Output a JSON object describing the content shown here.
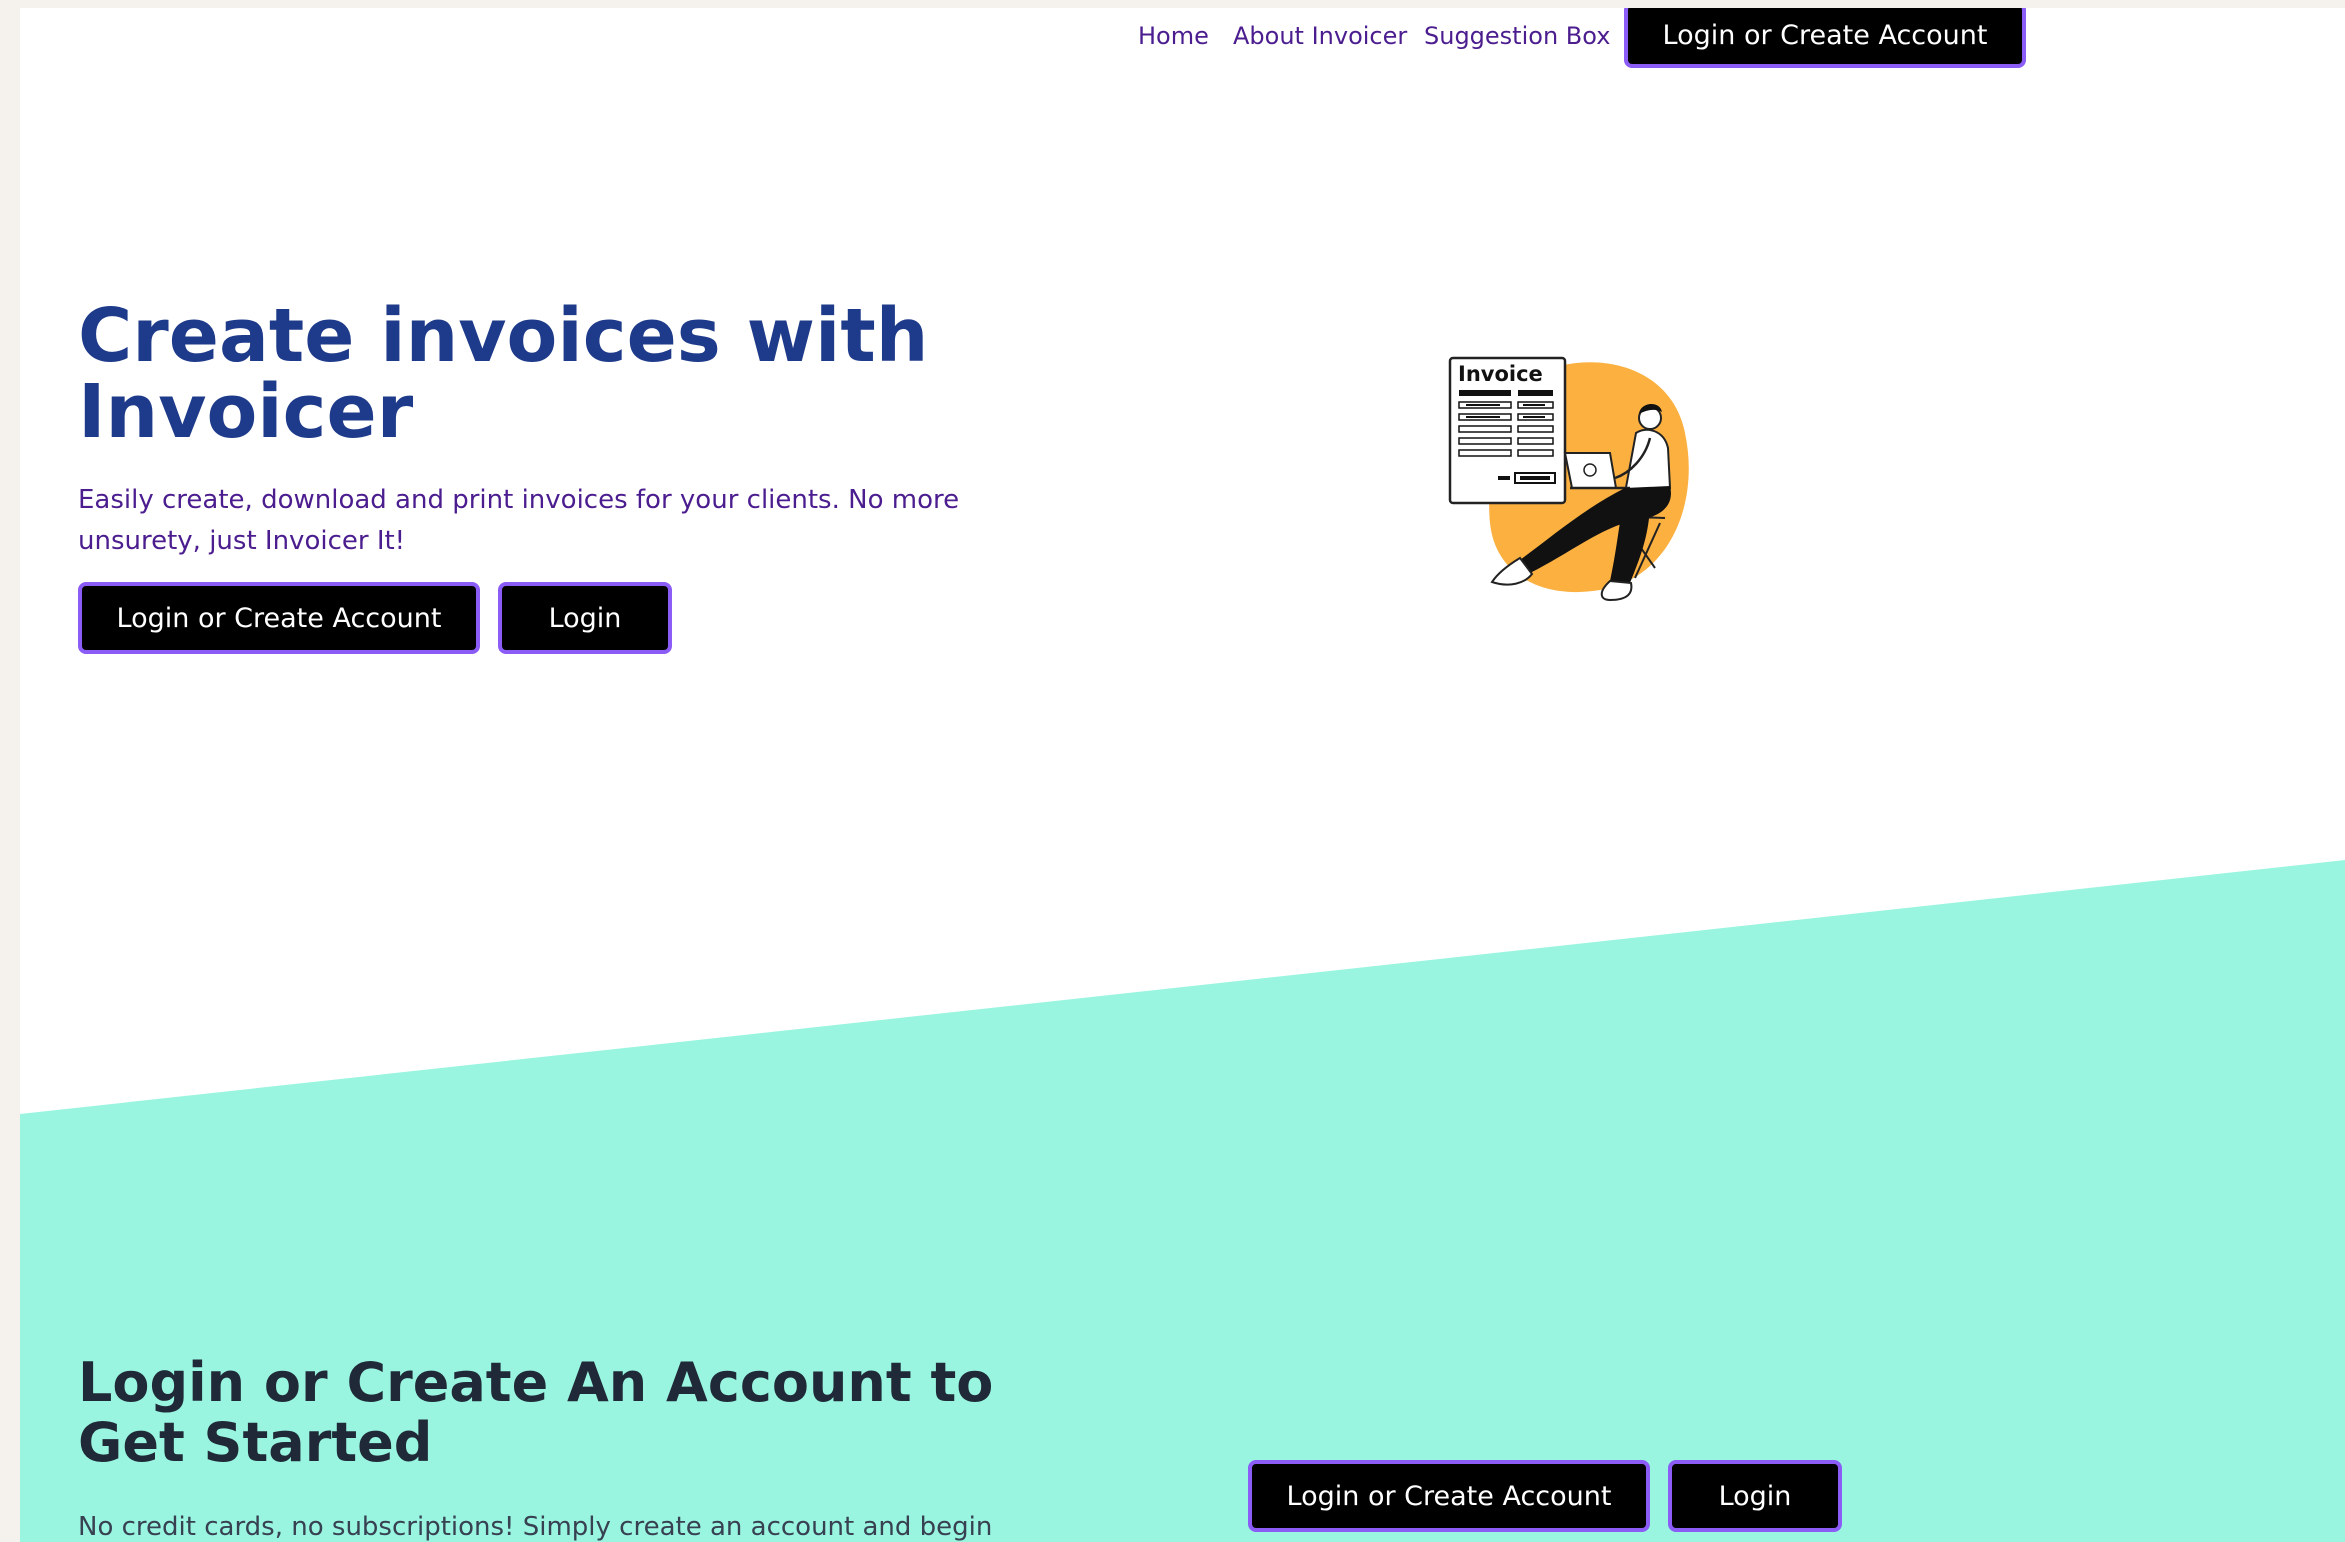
{
  "nav": {
    "links": [
      {
        "label": "Home"
      },
      {
        "label": "About Invoicer"
      },
      {
        "label": "Suggestion Box"
      }
    ],
    "cta_label": "Login or Create Account"
  },
  "hero": {
    "title": "Create invoices with Invoicer",
    "subtitle": "Easily create, download and print invoices for your clients. No more unsurety, just Invoicer It!",
    "primary_button": "Login or Create Account",
    "secondary_button": "Login",
    "illustration_label": "Invoice"
  },
  "cta": {
    "title": "Login or Create An Account to Get Started",
    "subtitle": "No credit cards, no subscriptions! Simply create an account and begin",
    "primary_button": "Login or Create Account",
    "secondary_button": "Login"
  },
  "colors": {
    "accent_border": "#8b5cf6",
    "heading": "#1e3a8a",
    "link": "#4b1d8f",
    "teal_band": "#99f5e0",
    "illustration_blob": "#fbb040"
  }
}
